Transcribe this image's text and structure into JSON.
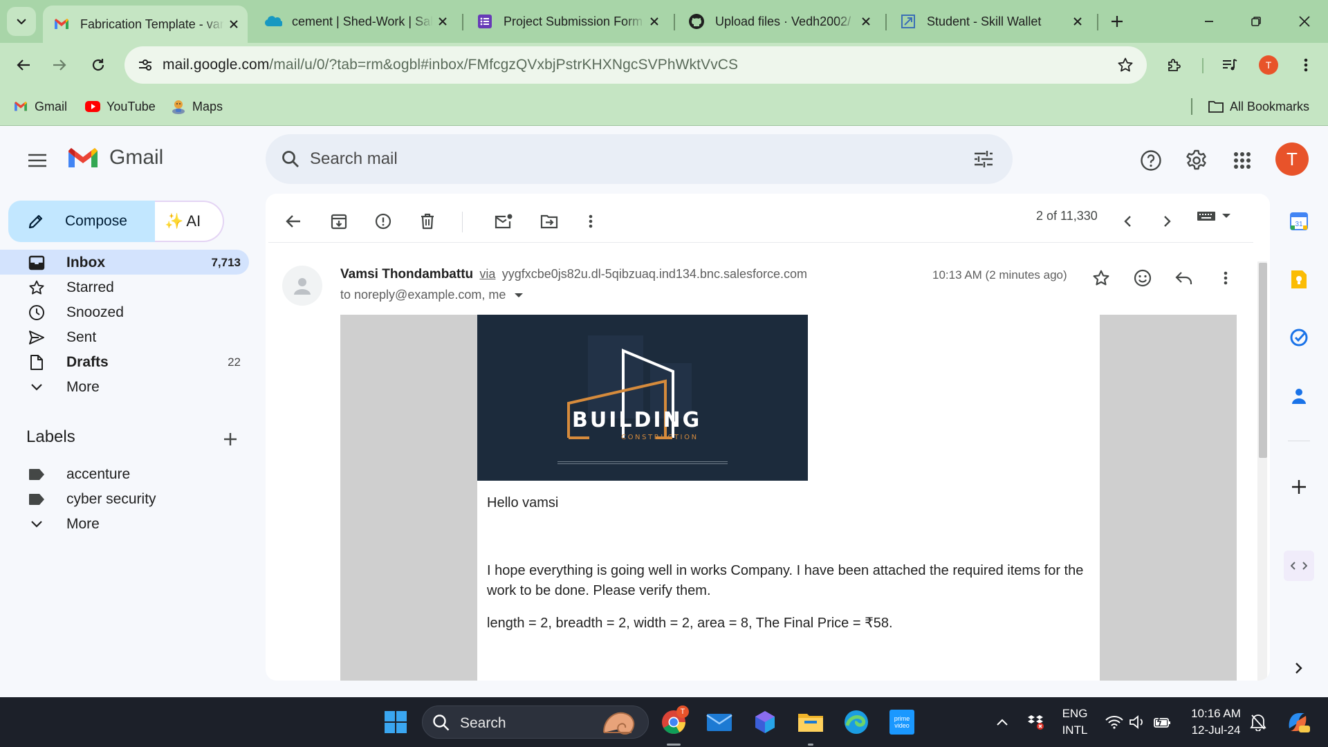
{
  "browser": {
    "tabs": [
      {
        "title": "Fabrication Template - vamsi",
        "icon": "gmail-icon",
        "active": true
      },
      {
        "title": "cement | Shed-Work | Salesforce",
        "icon": "salesforce-cloud-icon",
        "active": false
      },
      {
        "title": "Project Submission Form",
        "icon": "google-forms-icon",
        "active": false
      },
      {
        "title": "Upload files · Vedh2002/",
        "icon": "github-icon",
        "active": false
      },
      {
        "title": "Student - Skill Wallet",
        "icon": "skill-wallet-icon",
        "active": false
      }
    ],
    "url_host": "mail.google.com",
    "url_path": "/mail/u/0/?tab=rm&ogbl#inbox/FMfcgzQVxbjPstrKHXNgcSVPhWktVvCS",
    "profile_initial": "T",
    "bookmarks": [
      {
        "label": "Gmail",
        "icon": "gmail-icon"
      },
      {
        "label": "YouTube",
        "icon": "youtube-icon"
      },
      {
        "label": "Maps",
        "icon": "maps-icon"
      }
    ],
    "all_bookmarks_label": "All Bookmarks"
  },
  "gmail": {
    "logo_text": "Gmail",
    "search_placeholder": "Search mail",
    "avatar_initial": "T",
    "compose_label": "Compose",
    "ai_label": "AI",
    "nav": [
      {
        "label": "Inbox",
        "count": "7,713",
        "icon": "inbox-icon"
      },
      {
        "label": "Starred",
        "count": "",
        "icon": "star-outline-icon"
      },
      {
        "label": "Snoozed",
        "count": "",
        "icon": "clock-icon"
      },
      {
        "label": "Sent",
        "count": "",
        "icon": "send-icon"
      },
      {
        "label": "Drafts",
        "count": "22",
        "icon": "draft-file-icon"
      },
      {
        "label": "More",
        "count": "",
        "icon": "chevron-down-icon"
      }
    ],
    "labels_title": "Labels",
    "labels": [
      {
        "label": "accenture"
      },
      {
        "label": "cyber security"
      },
      {
        "label": "More"
      }
    ],
    "pager": "2 of 11,330",
    "message": {
      "sender_name": "Vamsi Thondambattu",
      "via": "via",
      "sender_address": "yygfxcbe0js82u.dl-5qibzuaq.ind134.bnc.salesforce.com",
      "to_line": "to noreply@example.com, me",
      "time": "10:13 AM (2 minutes ago)",
      "banner_title": "BUILDING",
      "banner_subtitle": "CONSTRUCTION",
      "greeting": "Hello vamsi",
      "paragraph": "I hope everything is going well in works Company. I have been attached the required items for the work to be done. Please verify them.",
      "details": "length = 2, breadth = 2, width = 2, area = 8, The Final Price = ₹58."
    }
  },
  "taskbar": {
    "search_label": "Search",
    "lang_line1": "ENG",
    "lang_line2": "INTL",
    "time": "10:16 AM",
    "date": "12-Jul-24",
    "chrome_badge": "T",
    "prime_label_1": "prime",
    "prime_label_2": "video"
  },
  "colors": {
    "chrome_frame": "#a8d5a8",
    "chrome_toolbar": "#c5e5c3",
    "gmail_compose": "#c2e7ff",
    "gmail_active_nav": "#d3e3fd",
    "avatar": "#e8532a",
    "banner_bg": "#1c2b3c",
    "banner_accent": "#d68b3c"
  }
}
